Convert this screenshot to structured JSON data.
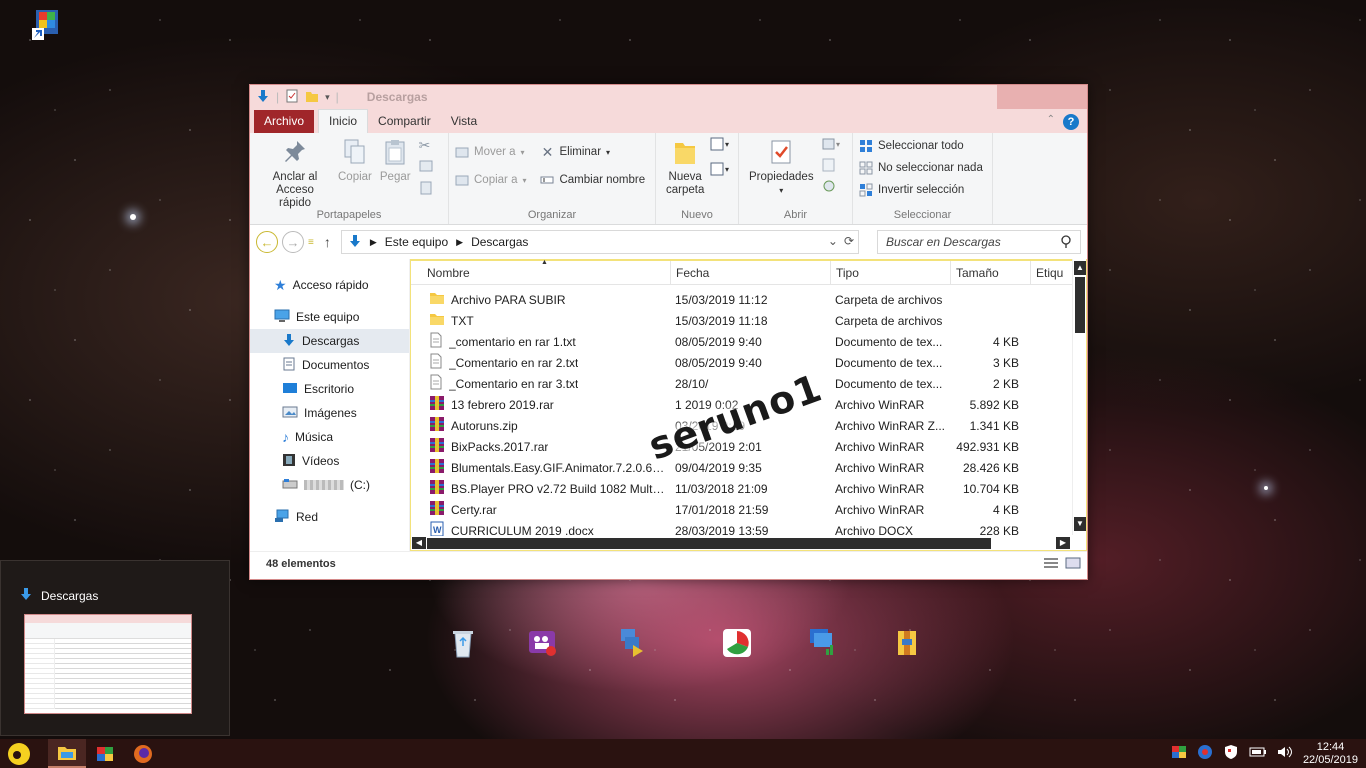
{
  "window": {
    "title": "Descargas",
    "tabs": [
      "Archivo",
      "Inicio",
      "Compartir",
      "Vista"
    ],
    "help": "?"
  },
  "ribbon": {
    "portapapeles": {
      "label": "Portapapeles",
      "pin": "Anclar al\nAcceso rápido",
      "pin1": "Anclar al",
      "pin2": "Acceso rápido",
      "copy": "Copiar",
      "paste": "Pegar"
    },
    "organizar": {
      "label": "Organizar",
      "move": "Mover a",
      "copyto": "Copiar a",
      "delete": "Eliminar",
      "rename": "Cambiar nombre"
    },
    "nuevo": {
      "label": "Nuevo",
      "new1": "Nueva",
      "new2": "carpeta"
    },
    "abrir": {
      "label": "Abrir",
      "props": "Propiedades"
    },
    "seleccionar": {
      "label": "Seleccionar",
      "all": "Seleccionar todo",
      "none": "No seleccionar nada",
      "invert": "Invertir selección"
    }
  },
  "address": {
    "crumbs": [
      "Este equipo",
      "Descargas"
    ],
    "search_placeholder": "Buscar en Descargas"
  },
  "nav": {
    "quick": "Acceso rápido",
    "pc": "Este equipo",
    "downloads": "Descargas",
    "documents": "Documentos",
    "desktop": "Escritorio",
    "images": "Imágenes",
    "music": "Música",
    "videos": "Vídeos",
    "drive": "(C:)",
    "network": "Red"
  },
  "columns": [
    "Nombre",
    "Fecha",
    "Tipo",
    "Tamaño",
    "Etiqu"
  ],
  "files": [
    {
      "name": "Archivo PARA SUBIR",
      "date": "15/03/2019 11:12",
      "type": "Carpeta de archivos",
      "size": "",
      "icon": "folder"
    },
    {
      "name": "TXT",
      "date": "15/03/2019 11:18",
      "type": "Carpeta de archivos",
      "size": "",
      "icon": "folder"
    },
    {
      "name": "_comentario en rar 1.txt",
      "date": "08/05/2019 9:40",
      "type": "Documento de tex...",
      "size": "4 KB",
      "icon": "txt"
    },
    {
      "name": "_Comentario en rar 2.txt",
      "date": "08/05/2019 9:40",
      "type": "Documento de tex...",
      "size": "3 KB",
      "icon": "txt"
    },
    {
      "name": "_Comentario en rar 3.txt",
      "date": "28/10/",
      "type": "Documento de tex...",
      "size": "2 KB",
      "icon": "txt"
    },
    {
      "name": "13 febrero 2019.rar",
      "date": "1 2019 0:02",
      "type": "Archivo WinRAR",
      "size": "5.892 KB",
      "icon": "rar"
    },
    {
      "name": "Autoruns.zip",
      "date": "03/2019 0:19",
      "type": "Archivo WinRAR Z...",
      "size": "1.341 KB",
      "icon": "rar"
    },
    {
      "name": "BixPacks.2017.rar",
      "date": "21/05/2019 2:01",
      "type": "Archivo WinRAR",
      "size": "492.931 KB",
      "icon": "rar"
    },
    {
      "name": "Blumentals.Easy.GIF.Animator.7.2.0.60....",
      "date": "09/04/2019 9:35",
      "type": "Archivo WinRAR",
      "size": "28.426 KB",
      "icon": "rar"
    },
    {
      "name": "BS.Player PRO v2.72 Build 1082 Multilin...",
      "date": "11/03/2018 21:09",
      "type": "Archivo WinRAR",
      "size": "10.704 KB",
      "icon": "rar"
    },
    {
      "name": "Certy.rar",
      "date": "17/01/2018 21:59",
      "type": "Archivo WinRAR",
      "size": "4 KB",
      "icon": "rar"
    },
    {
      "name": "CURRICULUM 2019 .docx",
      "date": "28/03/2019 13:59",
      "type": "Archivo DOCX",
      "size": "228 KB",
      "icon": "doc"
    }
  ],
  "status": "48 elementos",
  "watermark": "seruno1",
  "preview": {
    "title": "Descargas"
  },
  "clock": {
    "time": "12:44",
    "date": "22/05/2019"
  },
  "colors": {
    "file_tab": "#a0262a",
    "titlebar": "#f6dada",
    "taskbar": "#2a1210",
    "accent": "#1979ca"
  }
}
